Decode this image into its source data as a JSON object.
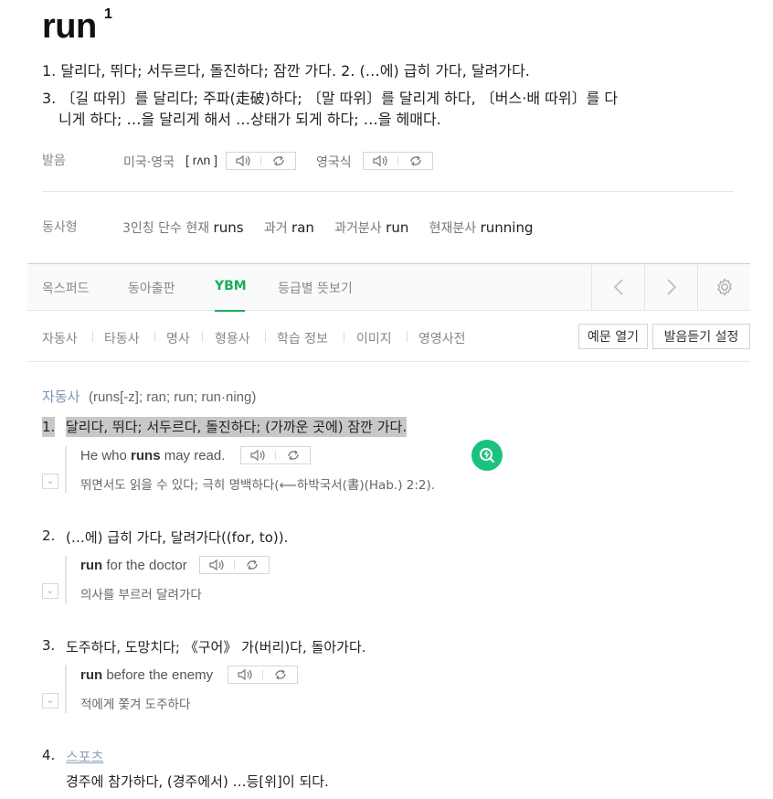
{
  "entry": {
    "word": "run",
    "homograph": "1"
  },
  "summary": {
    "line1": "1. 달리다, 뛰다; 서두르다, 돌진하다; 잠깐 가다.  2. (…에) 급히 가다, 달려가다.",
    "line2": "3. 〔길 따위〕를 달리다; 주파(走破)하다; 〔말 따위〕를 달리게 하다, 〔버스·배 따위〕를 다",
    "line3": "니게 하다; …을 달리게 해서 …상태가 되게 하다; …을 헤매다."
  },
  "pronunciation": {
    "label": "발음",
    "us_label": "미국·영국",
    "ipa": "[ rʌn ]",
    "uk_label": "영국식"
  },
  "verb_forms": {
    "label": "동사형",
    "third_person_label": "3인칭 단수 현재",
    "third_person": "runs",
    "past_label": "과거",
    "past": "ran",
    "past_participle_label": "과거분사",
    "past_participle": "run",
    "present_participle_label": "현재분사",
    "present_participle": "running"
  },
  "tabs": [
    {
      "label": "옥스퍼드",
      "active": false
    },
    {
      "label": "동아출판",
      "active": false
    },
    {
      "label": "YBM",
      "active": true
    },
    {
      "label": "등급별 뜻보기",
      "active": false
    }
  ],
  "nav": {
    "prev_icon": "chevron-left-icon",
    "next_icon": "chevron-right-icon",
    "settings_icon": "gear-icon"
  },
  "subnav": [
    "자동사",
    "타동사",
    "명사",
    "형용사",
    "학습 정보",
    "이미지",
    "영영사전"
  ],
  "buttons": {
    "open_examples": "예문 열기",
    "audio_settings": "발음듣기 설정"
  },
  "section": {
    "pos": "자동사",
    "forms": "(runs[-z]; ran; run; run·ning)"
  },
  "definitions": [
    {
      "num": "1.",
      "text": "달리다, 뛰다; 서두르다, 돌진하다; (가까운 곳에) 잠깐 가다.",
      "example_bold": "runs",
      "example_pre": "He who ",
      "example_post": " may read.",
      "translation": "뛰면서도 읽을 수 있다; 극히 명백하다(⟵하박국서(書)(Hab.) 2:2)."
    },
    {
      "num": "2.",
      "text": "(…에) 급히 가다, 달려가다((for, to)).",
      "example_bold": "run",
      "example_pre": "",
      "example_post": " for the doctor",
      "translation": "의사를 부르러 달려가다"
    },
    {
      "num": "3.",
      "text": "도주하다, 도망치다; 《구어》 가(버리)다, 돌아가다.",
      "example_bold": "run",
      "example_pre": "",
      "example_post": " before the enemy",
      "translation": "적에게 쫓겨 도주하다"
    },
    {
      "num": "4.",
      "field": "스포츠",
      "text": "경주에 참가하다, (경주에서) …등[위]이 되다."
    }
  ],
  "colors": {
    "accent": "#19ad5e",
    "highlight": "#c8c8c8",
    "pos_color": "#7a93b8"
  }
}
